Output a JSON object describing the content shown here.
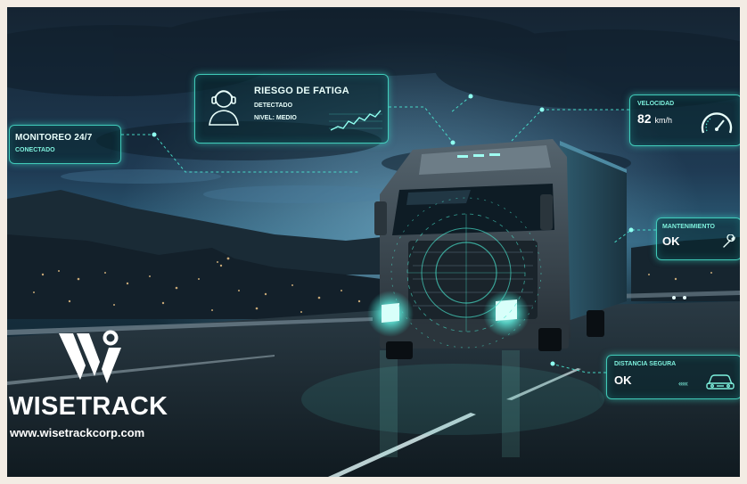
{
  "brand": {
    "name": "WISETRACK",
    "url": "www.wisetrackcorp.com",
    "logo_icon": "wisetrack-w-logo"
  },
  "panels": {
    "monitoring": {
      "title": "MONITOREO 24/7",
      "status": "CONECTADO"
    },
    "fatigue": {
      "title": "RIESGO DE FATIGA",
      "line1": "DETECTADO",
      "line2": "NIVEL: MEDIO",
      "icon": "driver-head-icon",
      "chart_icon": "trend-line-icon"
    },
    "speed": {
      "label": "VELOCIDAD",
      "value": "82",
      "unit": "km/h",
      "icon": "speedometer-icon"
    },
    "maintenance": {
      "label": "MANTENIMIENTO",
      "value": "OK",
      "icon": "wrench-icon"
    },
    "distance": {
      "label": "DISTANCIA SEGURA",
      "value": "OK",
      "arrows": "‹‹‹‹‹",
      "icon": "car-front-icon"
    }
  },
  "colors": {
    "accent": "#4ae6d0",
    "accent_soft": "#7ef2de",
    "night_sky": "#0c1a26",
    "road": "#1b2a34"
  }
}
